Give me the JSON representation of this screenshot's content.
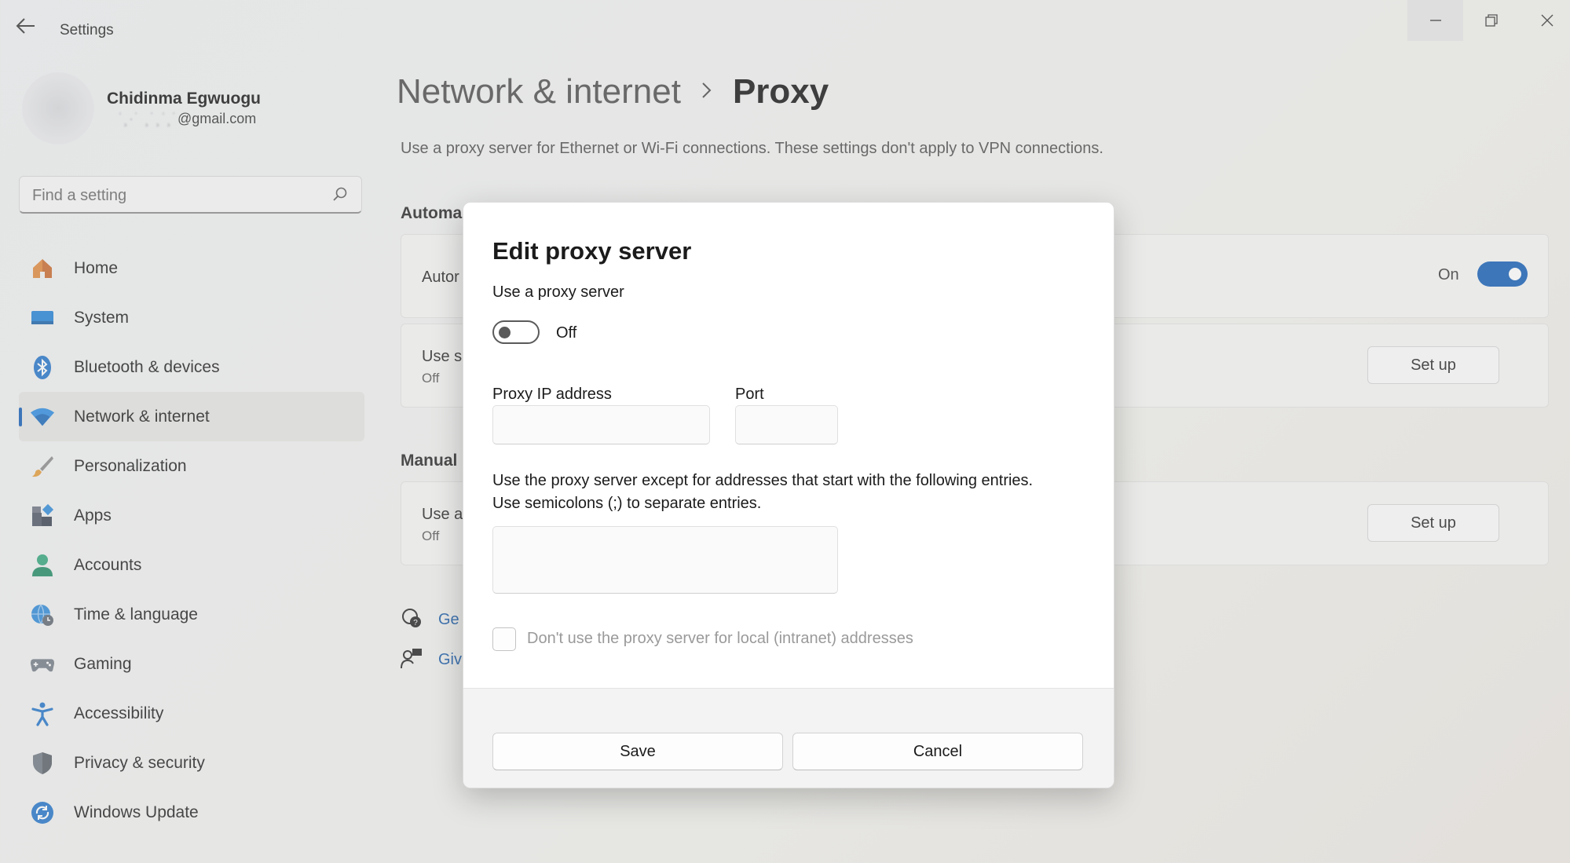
{
  "window": {
    "title": "Settings",
    "controls": {
      "minimize": "minimize-icon",
      "maximize": "restore-icon",
      "close": "close-icon"
    }
  },
  "profile": {
    "name": "Chidinma Egwuogu",
    "email_masked": "ʿ¸·˙ ¸˙¸ʿ¸˙",
    "email_domain": "@gmail.com"
  },
  "search": {
    "placeholder": "Find a setting",
    "value": ""
  },
  "sidebar": {
    "items": [
      {
        "label": "Home",
        "icon": "home-icon",
        "active": false
      },
      {
        "label": "System",
        "icon": "system-icon",
        "active": false
      },
      {
        "label": "Bluetooth & devices",
        "icon": "bluetooth-icon",
        "active": false
      },
      {
        "label": "Network & internet",
        "icon": "network-icon",
        "active": true
      },
      {
        "label": "Personalization",
        "icon": "brush-icon",
        "active": false
      },
      {
        "label": "Apps",
        "icon": "apps-icon",
        "active": false
      },
      {
        "label": "Accounts",
        "icon": "accounts-icon",
        "active": false
      },
      {
        "label": "Time & language",
        "icon": "time-language-icon",
        "active": false
      },
      {
        "label": "Gaming",
        "icon": "gaming-icon",
        "active": false
      },
      {
        "label": "Accessibility",
        "icon": "accessibility-icon",
        "active": false
      },
      {
        "label": "Privacy & security",
        "icon": "shield-icon",
        "active": false
      },
      {
        "label": "Windows Update",
        "icon": "update-icon",
        "active": false
      }
    ]
  },
  "main": {
    "breadcrumb": {
      "parent": "Network & internet",
      "current": "Proxy"
    },
    "description": "Use a proxy server for Ethernet or Wi-Fi connections. These settings don't apply to VPN connections.",
    "automatic": {
      "heading": "Automa",
      "auto_detect": {
        "title": "Autor",
        "state_label": "On",
        "on": true
      },
      "setup_script": {
        "title": "Use s",
        "status": "Off",
        "button": "Set up"
      }
    },
    "manual": {
      "heading": "Manual",
      "use_proxy": {
        "title": "Use a",
        "status": "Off",
        "button": "Set up"
      }
    },
    "links": [
      {
        "label": "Ge",
        "icon": "get-help-icon"
      },
      {
        "label": "Giv",
        "icon": "feedback-icon"
      }
    ]
  },
  "dialog": {
    "title": "Edit proxy server",
    "use_proxy_label": "Use a proxy server",
    "toggle_state": "Off",
    "ip_label": "Proxy IP address",
    "ip_value": "",
    "port_label": "Port",
    "port_value": "",
    "exceptions_line1": "Use the proxy server except for addresses that start with the following entries.",
    "exceptions_line2": "Use semicolons (;) to separate entries.",
    "exceptions_value": "",
    "local_checkbox_label": "Don't use the proxy server for local (intranet) addresses",
    "local_checked": false,
    "save_label": "Save",
    "cancel_label": "Cancel"
  },
  "colors": {
    "accent": "#0f5bb5",
    "link": "#1559a8"
  }
}
